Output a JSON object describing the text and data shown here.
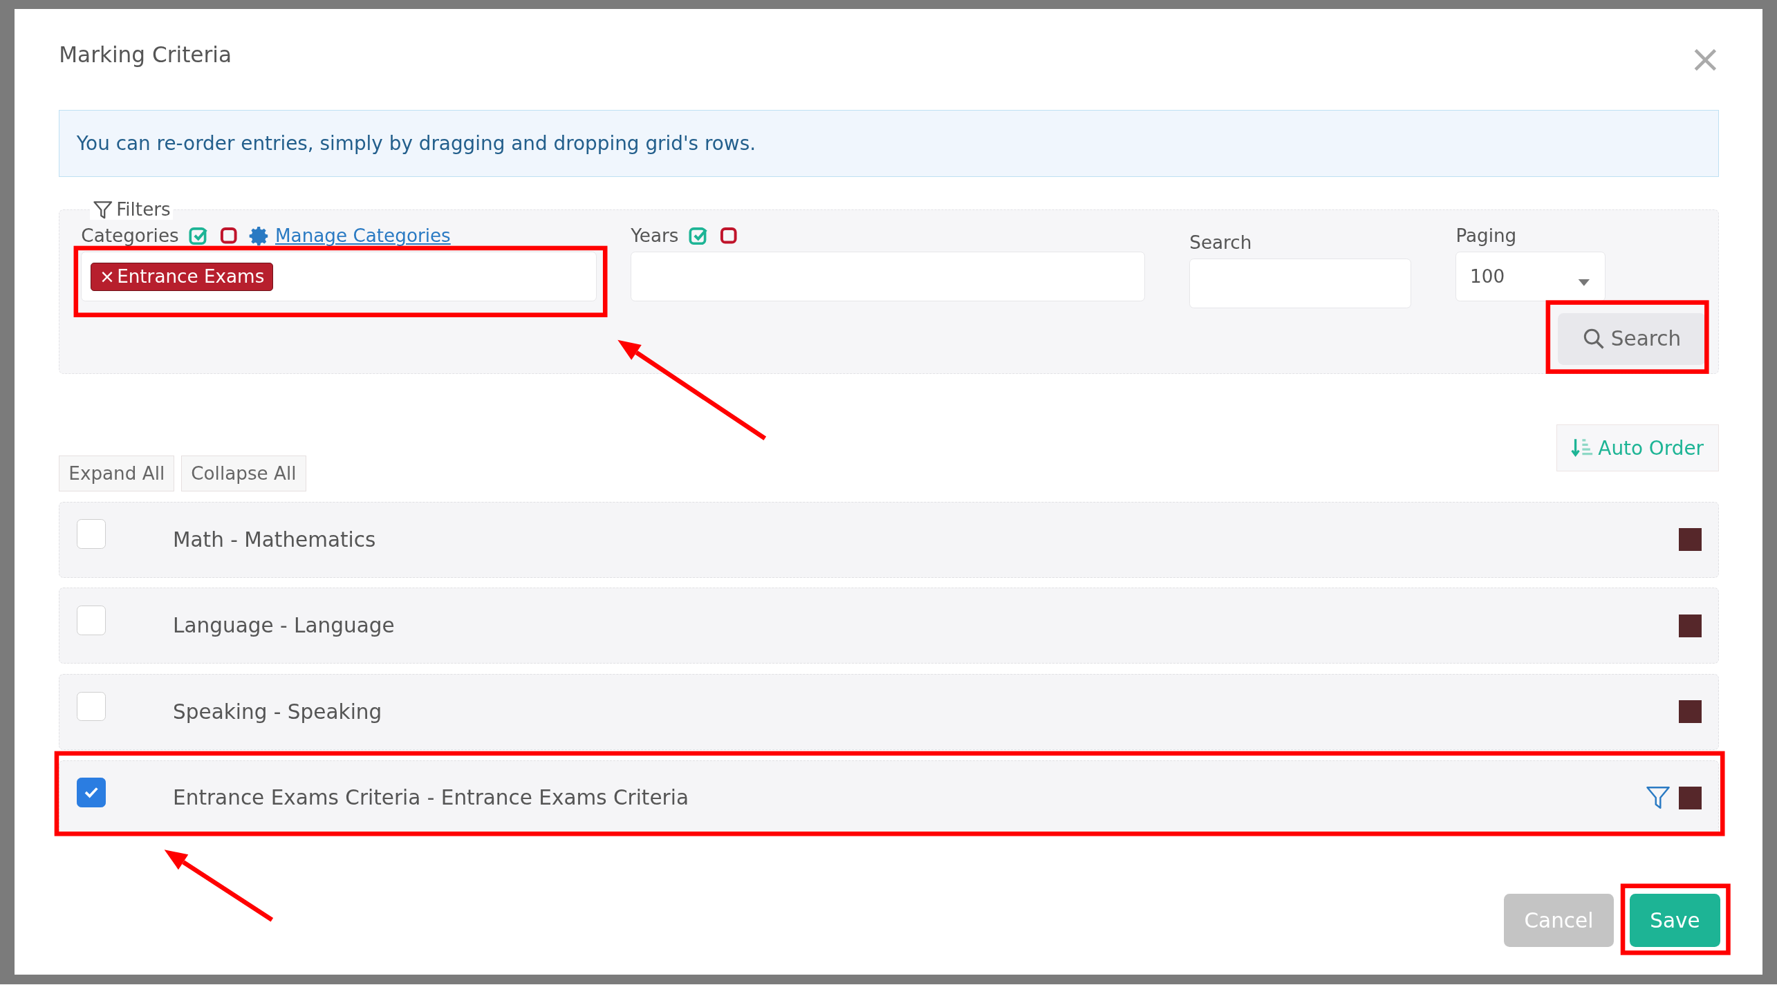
{
  "dialog": {
    "title": "Marking Criteria",
    "close": "×",
    "info": "You can re-order entries, simply by dragging and dropping grid's rows.",
    "filters": {
      "legend": "Filters",
      "categories": {
        "label": "Categories",
        "link": "Manage Categories",
        "tags": [
          {
            "remove": "×",
            "label": "Entrance Exams"
          }
        ]
      },
      "years": {
        "label": "Years"
      },
      "search": {
        "label": "Search"
      },
      "paging": {
        "label": "Paging",
        "value": "100"
      },
      "search_button": "Search"
    },
    "expand_all": "Expand All",
    "collapse_all": "Collapse All",
    "auto_order": "Auto Order",
    "rows": [
      {
        "label": "Math - Mathematics",
        "checked": false,
        "filtered": false,
        "color": "#56272a"
      },
      {
        "label": "Language - Language",
        "checked": false,
        "filtered": false,
        "color": "#56272a"
      },
      {
        "label": "Speaking - Speaking",
        "checked": false,
        "filtered": false,
        "color": "#56272a"
      },
      {
        "label": "Entrance Exams Criteria - Entrance Exams Criteria",
        "checked": true,
        "filtered": true,
        "color": "#56272a"
      }
    ],
    "buttons": [
      {
        "label": "Cancel",
        "kind": "secondary"
      },
      {
        "label": "Save",
        "kind": "primary"
      }
    ]
  }
}
